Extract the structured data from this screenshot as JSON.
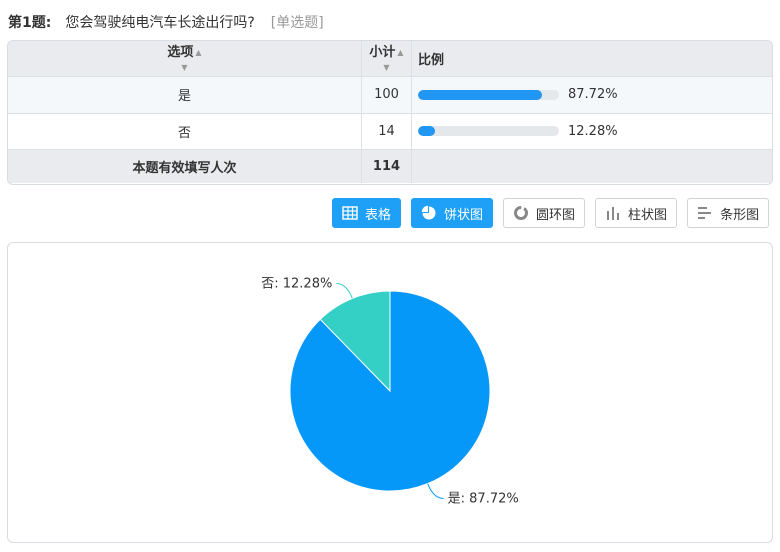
{
  "question": {
    "number_label": "第1题:",
    "text": "您会驾驶纯电汽车长途出行吗?",
    "type_label": "[单选题]"
  },
  "table": {
    "headers": {
      "option": "选项",
      "count": "小计",
      "ratio": "比例"
    },
    "rows": [
      {
        "option": "是",
        "count": "100",
        "ratio": 0.8772,
        "ratio_label": "87.72%"
      },
      {
        "option": "否",
        "count": "14",
        "ratio": 0.1228,
        "ratio_label": "12.28%"
      }
    ],
    "total_label": "本题有效填写人次",
    "total_count": "114"
  },
  "toolbar": {
    "buttons": [
      {
        "label": "表格",
        "icon": "table-icon",
        "active": true
      },
      {
        "label": "饼状图",
        "icon": "pie-icon",
        "active": true
      },
      {
        "label": "圆环图",
        "icon": "donut-icon",
        "active": false
      },
      {
        "label": "柱状图",
        "icon": "bar-chart-icon",
        "active": false
      },
      {
        "label": "条形图",
        "icon": "horizontal-bar-icon",
        "active": false
      }
    ]
  },
  "colors": {
    "accent": "#1ea0f6",
    "bar": "#2196f3",
    "pie_yes": "#0598f8",
    "pie_no": "#34d0c6"
  },
  "chart_data": {
    "type": "pie",
    "categories": [
      "是",
      "否"
    ],
    "values": [
      87.72,
      12.28
    ],
    "labels": [
      "是: 87.72%",
      "否: 12.28%"
    ],
    "colors": [
      "#0598f8",
      "#34d0c6"
    ]
  }
}
